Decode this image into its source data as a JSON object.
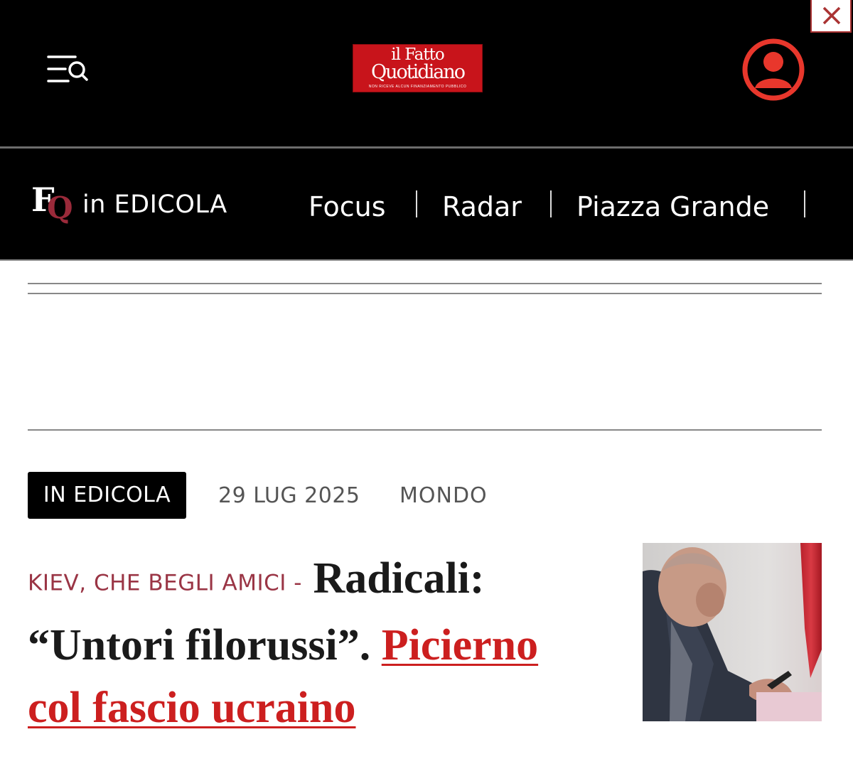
{
  "header": {
    "menu_icon": "menu-search-icon",
    "logo": {
      "line1": "il Fatto",
      "line2": "Quotidiano",
      "tagline": "NON RICEVE ALCUN FINANZIAMENTO PUBBLICO"
    },
    "user_icon": "user-account-icon",
    "close_icon": "close-icon"
  },
  "subnav": {
    "brand_mark": {
      "f": "F",
      "q": "Q"
    },
    "brand_label": "in EDICOLA",
    "links": [
      "Focus",
      "Radar",
      "Piazza Grande"
    ]
  },
  "article": {
    "tag": "IN EDICOLA",
    "date": "29 LUG 2025",
    "section": "MONDO",
    "kicker": "KIEV, CHE BEGLI AMICI -",
    "headline_main": "Radicali: “Untori filorussi”.",
    "headline_link": "Picierno col fascio ucraino",
    "image_icon": "article-photo"
  },
  "colors": {
    "header_bg": "#000000",
    "logo_red": "#c8141b",
    "user_icon_red": "#e8372c",
    "kicker_color": "#9a3545",
    "link_red": "#cc1f1f",
    "tag_bg": "#000000"
  }
}
